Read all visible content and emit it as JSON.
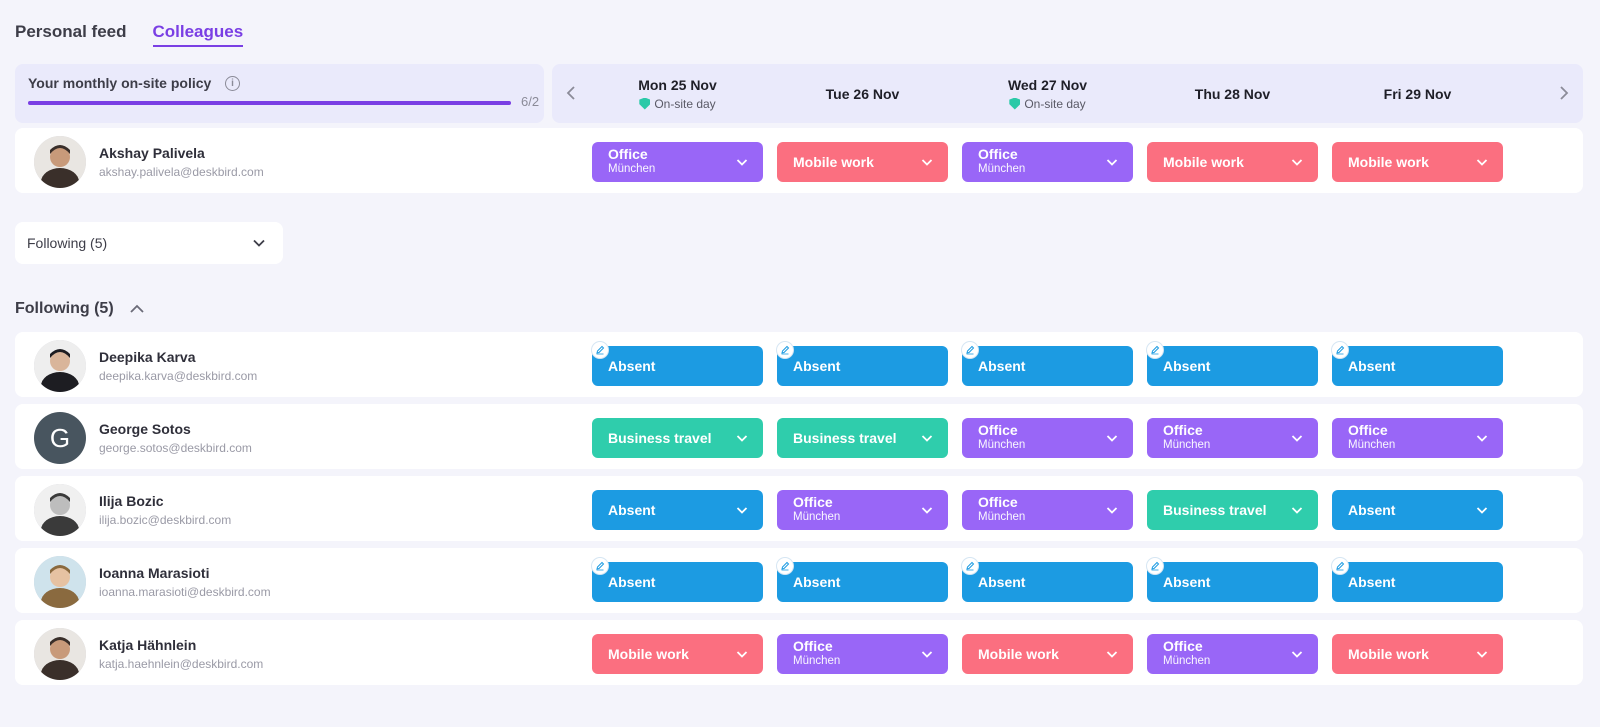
{
  "colors": {
    "office": "#9966f7",
    "mobile": "#fb6f80",
    "absent": "#1c9be2",
    "travel": "#2fcdac",
    "accent": "#7a3fe4",
    "onsite": "#2bc9a8"
  },
  "tabs": [
    {
      "label": "Personal feed",
      "active": false
    },
    {
      "label": "Colleagues",
      "active": true
    }
  ],
  "policy": {
    "title": "Your monthly on-site policy",
    "count": "6/2",
    "progress": 1.0
  },
  "days": [
    {
      "label": "Mon 25 Nov",
      "onsite": "On-site day"
    },
    {
      "label": "Tue 26 Nov",
      "onsite": ""
    },
    {
      "label": "Wed 27 Nov",
      "onsite": "On-site day"
    },
    {
      "label": "Thu 28 Nov",
      "onsite": ""
    },
    {
      "label": "Fri 29 Nov",
      "onsite": ""
    }
  ],
  "me": {
    "name": "Akshay Palivela",
    "email": "akshay.palivela@deskbird.com",
    "statuses": [
      {
        "type": "office",
        "label": "Office",
        "sub": "München",
        "dropdown": true,
        "edited": false
      },
      {
        "type": "mobile",
        "label": "Mobile work",
        "sub": "",
        "dropdown": true,
        "edited": false
      },
      {
        "type": "office",
        "label": "Office",
        "sub": "München",
        "dropdown": true,
        "edited": false
      },
      {
        "type": "mobile",
        "label": "Mobile work",
        "sub": "",
        "dropdown": true,
        "edited": false
      },
      {
        "type": "mobile",
        "label": "Mobile work",
        "sub": "",
        "dropdown": true,
        "edited": false
      }
    ]
  },
  "following_dropdown": {
    "label": "Following (5)"
  },
  "following_section": {
    "title": "Following (5)"
  },
  "following": [
    {
      "name": "Deepika Karva",
      "email": "deepika.karva@deskbird.com",
      "avatar": "photo",
      "statuses": [
        {
          "type": "absent",
          "label": "Absent",
          "sub": "",
          "dropdown": false,
          "edited": true
        },
        {
          "type": "absent",
          "label": "Absent",
          "sub": "",
          "dropdown": false,
          "edited": true
        },
        {
          "type": "absent",
          "label": "Absent",
          "sub": "",
          "dropdown": false,
          "edited": true
        },
        {
          "type": "absent",
          "label": "Absent",
          "sub": "",
          "dropdown": false,
          "edited": true
        },
        {
          "type": "absent",
          "label": "Absent",
          "sub": "",
          "dropdown": false,
          "edited": true
        }
      ]
    },
    {
      "name": "George Sotos",
      "email": "george.sotos@deskbird.com",
      "avatar": "letter",
      "avatar_letter": "G",
      "statuses": [
        {
          "type": "travel",
          "label": "Business travel",
          "sub": "",
          "dropdown": true,
          "edited": false
        },
        {
          "type": "travel",
          "label": "Business travel",
          "sub": "",
          "dropdown": true,
          "edited": false
        },
        {
          "type": "office",
          "label": "Office",
          "sub": "München",
          "dropdown": true,
          "edited": false
        },
        {
          "type": "office",
          "label": "Office",
          "sub": "München",
          "dropdown": true,
          "edited": false
        },
        {
          "type": "office",
          "label": "Office",
          "sub": "München",
          "dropdown": true,
          "edited": false
        }
      ]
    },
    {
      "name": "Ilija Bozic",
      "email": "ilija.bozic@deskbird.com",
      "avatar": "photo",
      "statuses": [
        {
          "type": "absent",
          "label": "Absent",
          "sub": "",
          "dropdown": true,
          "edited": false
        },
        {
          "type": "office",
          "label": "Office",
          "sub": "München",
          "dropdown": true,
          "edited": false
        },
        {
          "type": "office",
          "label": "Office",
          "sub": "München",
          "dropdown": true,
          "edited": false
        },
        {
          "type": "travel",
          "label": "Business travel",
          "sub": "",
          "dropdown": true,
          "edited": false
        },
        {
          "type": "absent",
          "label": "Absent",
          "sub": "",
          "dropdown": true,
          "edited": false
        }
      ]
    },
    {
      "name": "Ioanna Marasioti",
      "email": "ioanna.marasioti@deskbird.com",
      "avatar": "photo",
      "statuses": [
        {
          "type": "absent",
          "label": "Absent",
          "sub": "",
          "dropdown": false,
          "edited": true
        },
        {
          "type": "absent",
          "label": "Absent",
          "sub": "",
          "dropdown": false,
          "edited": true
        },
        {
          "type": "absent",
          "label": "Absent",
          "sub": "",
          "dropdown": false,
          "edited": true
        },
        {
          "type": "absent",
          "label": "Absent",
          "sub": "",
          "dropdown": false,
          "edited": true
        },
        {
          "type": "absent",
          "label": "Absent",
          "sub": "",
          "dropdown": false,
          "edited": true
        }
      ]
    },
    {
      "name": "Katja Hähnlein",
      "email": "katja.haehnlein@deskbird.com",
      "avatar": "photo",
      "statuses": [
        {
          "type": "mobile",
          "label": "Mobile work",
          "sub": "",
          "dropdown": true,
          "edited": false
        },
        {
          "type": "office",
          "label": "Office",
          "sub": "München",
          "dropdown": true,
          "edited": false
        },
        {
          "type": "mobile",
          "label": "Mobile work",
          "sub": "",
          "dropdown": true,
          "edited": false
        },
        {
          "type": "office",
          "label": "Office",
          "sub": "München",
          "dropdown": true,
          "edited": false
        },
        {
          "type": "mobile",
          "label": "Mobile work",
          "sub": "",
          "dropdown": true,
          "edited": false
        }
      ]
    }
  ]
}
